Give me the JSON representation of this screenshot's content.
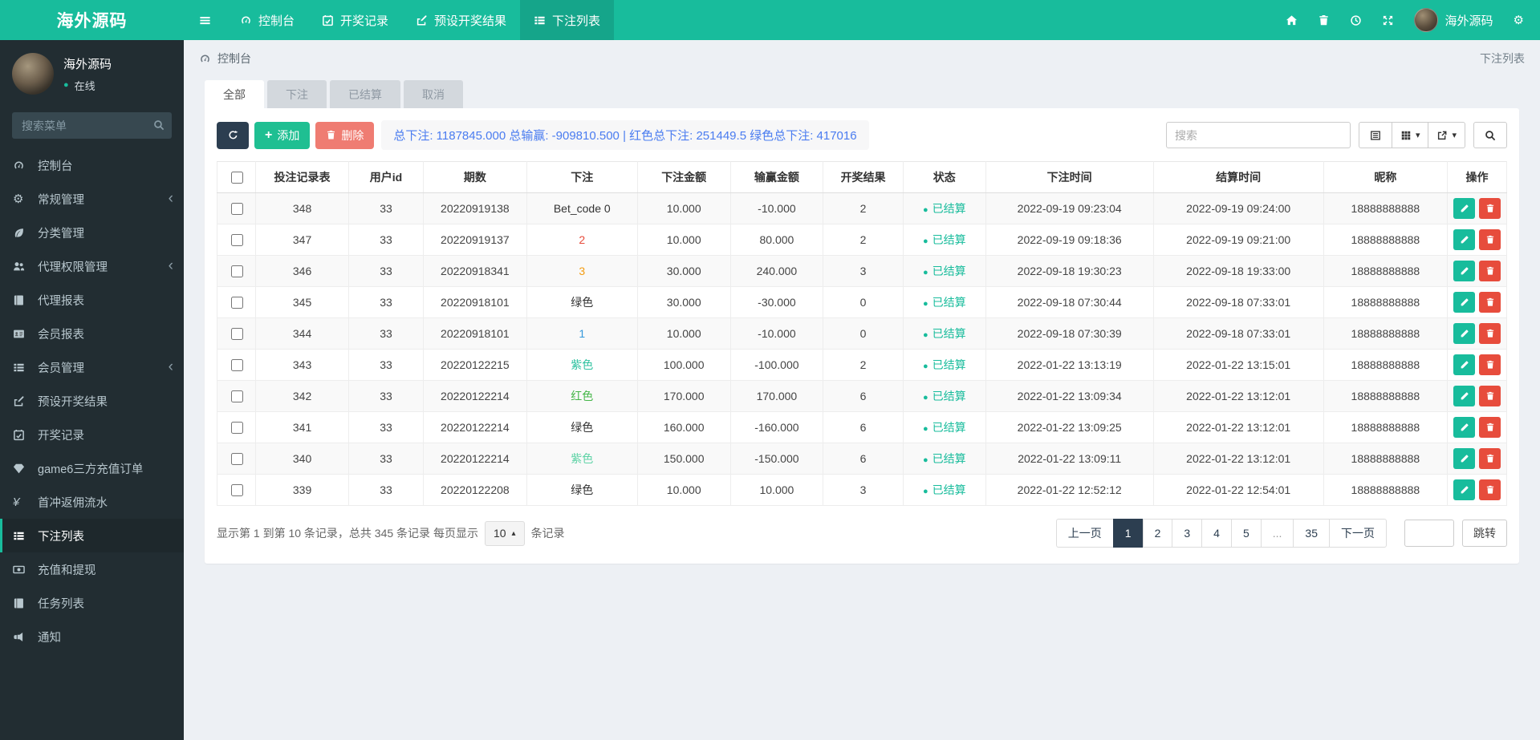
{
  "brand": {
    "logo": "海外源码"
  },
  "navbar": {
    "items": [
      {
        "key": "dashboard",
        "label": "控制台",
        "icon": "tachometer",
        "active": false
      },
      {
        "key": "lottery-records",
        "label": "开奖记录",
        "icon": "calendar",
        "active": false
      },
      {
        "key": "preset-results",
        "label": "预设开奖结果",
        "icon": "preset",
        "active": false
      },
      {
        "key": "bet-list",
        "label": "下注列表",
        "icon": "list",
        "active": true
      }
    ],
    "right": {
      "username": "海外源码"
    }
  },
  "sidebar": {
    "user": {
      "name": "海外源码",
      "status_dot": "●",
      "status": "在线"
    },
    "search_placeholder": "搜索菜单",
    "items": [
      {
        "key": "dashboard",
        "label": "控制台",
        "icon": "tachometer",
        "chevron": false,
        "active": false
      },
      {
        "key": "general-management",
        "label": "常规管理",
        "icon": "gears",
        "chevron": true,
        "active": false
      },
      {
        "key": "category-management",
        "label": "分类管理",
        "icon": "leaf",
        "chevron": false,
        "active": false
      },
      {
        "key": "agent-permission",
        "label": "代理权限管理",
        "icon": "users",
        "chevron": true,
        "active": false
      },
      {
        "key": "agent-report",
        "label": "代理报表",
        "icon": "book",
        "chevron": false,
        "active": false
      },
      {
        "key": "member-report",
        "label": "会员报表",
        "icon": "idcard",
        "chevron": false,
        "active": false
      },
      {
        "key": "member-management",
        "label": "会员管理",
        "icon": "list",
        "chevron": true,
        "active": false
      },
      {
        "key": "preset-results",
        "label": "预设开奖结果",
        "icon": "preset",
        "chevron": false,
        "active": false
      },
      {
        "key": "lottery-records",
        "label": "开奖记录",
        "icon": "calendar",
        "chevron": false,
        "active": false
      },
      {
        "key": "game6-orders",
        "label": "game6三方充值订单",
        "icon": "gem",
        "chevron": false,
        "active": false
      },
      {
        "key": "first-charge-rebate",
        "label": "首冲返佣流水",
        "icon": "yen",
        "chevron": false,
        "active": false
      },
      {
        "key": "bet-list",
        "label": "下注列表",
        "icon": "list",
        "chevron": false,
        "active": true
      },
      {
        "key": "recharge-withdraw",
        "label": "充值和提现",
        "icon": "money",
        "chevron": false,
        "active": false
      },
      {
        "key": "task-list",
        "label": "任务列表",
        "icon": "book",
        "chevron": false,
        "active": false
      },
      {
        "key": "notice",
        "label": "通知",
        "icon": "bullhorn",
        "chevron": false,
        "active": false
      }
    ]
  },
  "breadcrumb": {
    "left": "控制台",
    "right": "下注列表"
  },
  "tabs": [
    {
      "key": "all",
      "label": "全部",
      "active": true
    },
    {
      "key": "bet",
      "label": "下注",
      "active": false
    },
    {
      "key": "settled",
      "label": "已结算",
      "active": false
    },
    {
      "key": "cancel",
      "label": "取消",
      "active": false
    }
  ],
  "toolbar": {
    "add_label": "添加",
    "delete_label": "删除",
    "summary": "总下注: 1187845.000 总输赢: -909810.500 | 红色总下注: 251449.5 绿色总下注: 417016",
    "search_placeholder": "搜索"
  },
  "table": {
    "columns": [
      "投注记录表",
      "用户id",
      "期数",
      "下注",
      "下注金额",
      "输赢金额",
      "开奖结果",
      "状态",
      "下注时间",
      "结算时间",
      "昵称",
      "操作"
    ],
    "status_dot": "●",
    "rows": [
      {
        "id": "348",
        "uid": "33",
        "period": "20220919138",
        "bet": "Bet_code 0",
        "bet_color": "#333333",
        "amount": "10.000",
        "winloss": "-10.000",
        "result": "2",
        "status": "已结算",
        "bet_time": "2022-09-19 09:23:04",
        "settle_time": "2022-09-19 09:24:00",
        "nickname": "18888888888"
      },
      {
        "id": "347",
        "uid": "33",
        "period": "20220919137",
        "bet": "2",
        "bet_color": "#e74c3c",
        "amount": "10.000",
        "winloss": "80.000",
        "result": "2",
        "status": "已结算",
        "bet_time": "2022-09-19 09:18:36",
        "settle_time": "2022-09-19 09:21:00",
        "nickname": "18888888888"
      },
      {
        "id": "346",
        "uid": "33",
        "period": "20220918341",
        "bet": "3",
        "bet_color": "#f39c12",
        "amount": "30.000",
        "winloss": "240.000",
        "result": "3",
        "status": "已结算",
        "bet_time": "2022-09-18 19:30:23",
        "settle_time": "2022-09-18 19:33:00",
        "nickname": "18888888888"
      },
      {
        "id": "345",
        "uid": "33",
        "period": "20220918101",
        "bet": "绿色",
        "bet_color": "#333333",
        "amount": "30.000",
        "winloss": "-30.000",
        "result": "0",
        "status": "已结算",
        "bet_time": "2022-09-18 07:30:44",
        "settle_time": "2022-09-18 07:33:01",
        "nickname": "18888888888"
      },
      {
        "id": "344",
        "uid": "33",
        "period": "20220918101",
        "bet": "1",
        "bet_color": "#3498db",
        "amount": "10.000",
        "winloss": "-10.000",
        "result": "0",
        "status": "已结算",
        "bet_time": "2022-09-18 07:30:39",
        "settle_time": "2022-09-18 07:33:01",
        "nickname": "18888888888"
      },
      {
        "id": "343",
        "uid": "33",
        "period": "20220122215",
        "bet": "紫色",
        "bet_color": "#2fc2a0",
        "amount": "100.000",
        "winloss": "-100.000",
        "result": "2",
        "status": "已结算",
        "bet_time": "2022-01-22 13:13:19",
        "settle_time": "2022-01-22 13:15:01",
        "nickname": "18888888888"
      },
      {
        "id": "342",
        "uid": "33",
        "period": "20220122214",
        "bet": "红色",
        "bet_color": "#45b649",
        "amount": "170.000",
        "winloss": "170.000",
        "result": "6",
        "status": "已结算",
        "bet_time": "2022-01-22 13:09:34",
        "settle_time": "2022-01-22 13:12:01",
        "nickname": "18888888888"
      },
      {
        "id": "341",
        "uid": "33",
        "period": "20220122214",
        "bet": "绿色",
        "bet_color": "#333333",
        "amount": "160.000",
        "winloss": "-160.000",
        "result": "6",
        "status": "已结算",
        "bet_time": "2022-01-22 13:09:25",
        "settle_time": "2022-01-22 13:12:01",
        "nickname": "18888888888"
      },
      {
        "id": "340",
        "uid": "33",
        "period": "20220122214",
        "bet": "紫色",
        "bet_color": "#5fd3a6",
        "amount": "150.000",
        "winloss": "-150.000",
        "result": "6",
        "status": "已结算",
        "bet_time": "2022-01-22 13:09:11",
        "settle_time": "2022-01-22 13:12:01",
        "nickname": "18888888888"
      },
      {
        "id": "339",
        "uid": "33",
        "period": "20220122208",
        "bet": "绿色",
        "bet_color": "#333333",
        "amount": "10.000",
        "winloss": "10.000",
        "result": "3",
        "status": "已结算",
        "bet_time": "2022-01-22 12:52:12",
        "settle_time": "2022-01-22 12:54:01",
        "nickname": "18888888888"
      }
    ]
  },
  "footer": {
    "info_prefix": "显示第 1 到第 10 条记录，总共 345 条记录 每页显示",
    "page_size": "10",
    "info_suffix": "条记录",
    "pagination": {
      "prev": "上一页",
      "next": "下一页",
      "pages": [
        "1",
        "2",
        "3",
        "4",
        "5",
        "...",
        "35"
      ],
      "active": "1",
      "jump_label": "跳转"
    }
  },
  "colors": {
    "accent_teal": "#18bc9c",
    "navy": "#2c3e50",
    "danger_red": "#e74c3c",
    "delete_salmon": "#ef7c72",
    "summary_blue": "#4a7cf0",
    "sidebar_bg": "#222d32",
    "page_bg": "#edf0f4"
  }
}
